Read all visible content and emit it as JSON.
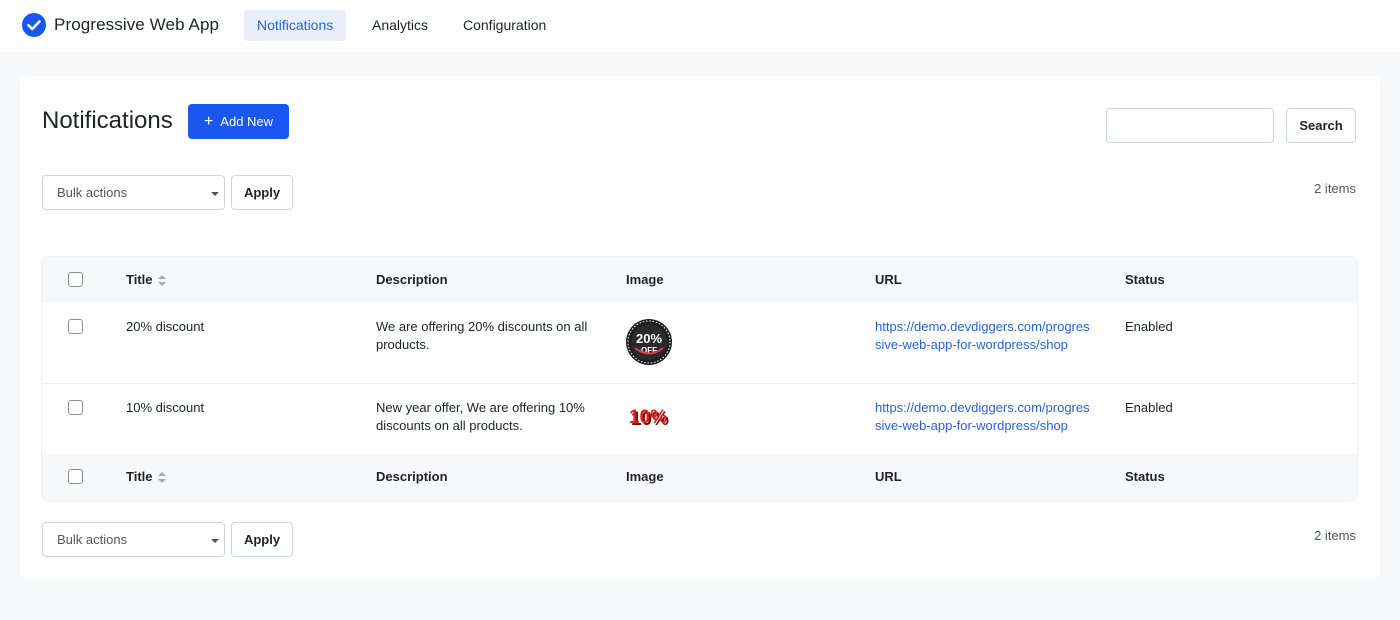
{
  "app": {
    "name": "Progressive Web App",
    "brand_color": "#1a56f0"
  },
  "nav": {
    "tabs": [
      {
        "label": "Notifications",
        "active": true
      },
      {
        "label": "Analytics",
        "active": false
      },
      {
        "label": "Configuration",
        "active": false
      }
    ]
  },
  "page": {
    "title": "Notifications",
    "add_button_label": "Add New",
    "search_placeholder": "",
    "search_value": "",
    "search_button_label": "Search",
    "items_count": "2 items"
  },
  "bulk": {
    "selected": "Bulk actions",
    "apply_label": "Apply"
  },
  "table": {
    "columns": [
      "Title",
      "Description",
      "Image",
      "URL",
      "Status"
    ],
    "rows": [
      {
        "title": "20% discount",
        "description": [
          "We are offering 20% discounts on all",
          "products."
        ],
        "image": "20-percent-off-badge",
        "image_text": [
          "20%",
          "OFF"
        ],
        "url": [
          "https://demo.devdiggers.com/progres",
          "sive-web-app-for-wordpress/shop"
        ],
        "status": "Enabled"
      },
      {
        "title": "10% discount",
        "description": [
          "New year offer, We are offering 10%",
          "discounts on all products."
        ],
        "image": "10-percent-red-3d-text",
        "image_text": [
          "10%"
        ],
        "url": [
          "https://demo.devdiggers.com/progres",
          "sive-web-app-for-wordpress/shop"
        ],
        "status": "Enabled"
      }
    ]
  }
}
